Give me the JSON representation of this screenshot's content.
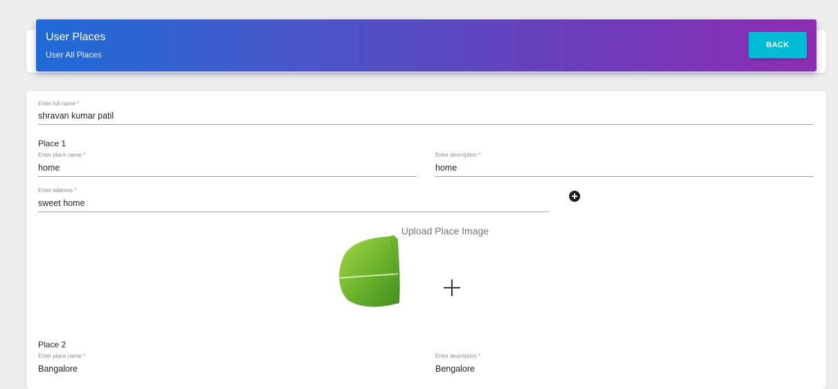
{
  "header": {
    "title": "User Places",
    "subtitle": "User All Places",
    "back_label": "BACK"
  },
  "form": {
    "full_name": {
      "label": "Enter full name *",
      "value": "shravan kumar patil"
    },
    "places": [
      {
        "title": "Place 1",
        "place_name": {
          "label": "Enter place name *",
          "value": "home"
        },
        "description": {
          "label": "Enter description *",
          "value": "home"
        },
        "address": {
          "label": "Enter address *",
          "value": "sweet home"
        },
        "upload_title": "Upload Place Image"
      },
      {
        "title": "Place 2",
        "place_name": {
          "label": "Enter place name *",
          "value": "Bangalore"
        },
        "description": {
          "label": "Enter description *",
          "value": "Bengalore"
        }
      }
    ]
  },
  "colors": {
    "header_gradient_start": "#1e6bd8",
    "header_gradient_end": "#8e2db2",
    "back_button": "#00bcd4"
  },
  "icons": {
    "add_place": "plus-circle-icon",
    "upload_image": "plus-icon"
  }
}
